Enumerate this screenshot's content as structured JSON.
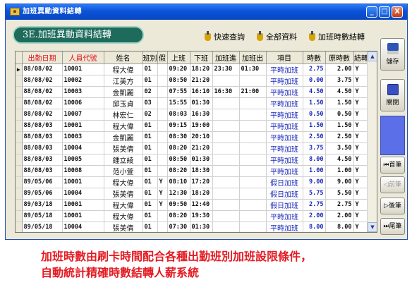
{
  "window": {
    "title": "加班異動資料結轉",
    "min_label": "_",
    "max_label": "□",
    "close_label": "X"
  },
  "header": {
    "section": "3E.加班異動資料結轉",
    "links": [
      "快速查詢",
      "全部資料",
      "加班時數結轉"
    ]
  },
  "table": {
    "columns": [
      "出勤日期",
      "人員代號",
      "姓名",
      "班別",
      "假",
      "上班",
      "下班",
      "加班進",
      "加班出",
      "項目",
      "時數",
      "原時數",
      "結轉"
    ],
    "rows": [
      [
        "88/08/02",
        "10001",
        "程大偉",
        "01",
        "",
        "09:20",
        "18:20",
        "23:30",
        "01:30",
        "平時加班",
        "2.75",
        "2.00",
        "Y"
      ],
      [
        "88/08/02",
        "10002",
        "江美方",
        "01",
        "",
        "08:50",
        "21:20",
        "",
        "",
        "平時加班",
        "0.00",
        "3.75",
        "Y"
      ],
      [
        "88/08/02",
        "10003",
        "金凱麗",
        "02",
        "",
        "07:55",
        "16:10",
        "16:30",
        "21:00",
        "平時加班",
        "4.50",
        "4.50",
        "Y"
      ],
      [
        "88/08/02",
        "10006",
        "邱玉貞",
        "03",
        "",
        "15:55",
        "01:30",
        "",
        "",
        "平時加班",
        "1.50",
        "1.50",
        "Y"
      ],
      [
        "88/08/02",
        "10007",
        "林宏仁",
        "02",
        "",
        "08:03",
        "16:30",
        "",
        "",
        "平時加班",
        "0.50",
        "0.50",
        "Y"
      ],
      [
        "88/08/03",
        "10001",
        "程大偉",
        "01",
        "",
        "09:15",
        "19:00",
        "",
        "",
        "平時加班",
        "1.50",
        "1.50",
        "Y"
      ],
      [
        "88/08/03",
        "10003",
        "金凱麗",
        "01",
        "",
        "08:30",
        "20:10",
        "",
        "",
        "平時加班",
        "2.50",
        "2.50",
        "Y"
      ],
      [
        "88/08/03",
        "10004",
        "張美倩",
        "01",
        "",
        "08:20",
        "21:20",
        "",
        "",
        "平時加班",
        "3.75",
        "3.50",
        "Y"
      ],
      [
        "88/08/03",
        "10005",
        "鍾立綾",
        "01",
        "",
        "08:50",
        "01:30",
        "",
        "",
        "平時加班",
        "8.00",
        "4.50",
        "Y"
      ],
      [
        "88/08/03",
        "10008",
        "范小萱",
        "01",
        "",
        "08:20",
        "18:30",
        "",
        "",
        "平時加班",
        "1.00",
        "1.00",
        "Y"
      ],
      [
        "89/05/06",
        "10001",
        "程大偉",
        "01",
        "Y",
        "08:10",
        "17:20",
        "",
        "",
        "假日加班",
        "9.00",
        "9.00",
        "Y"
      ],
      [
        "89/05/06",
        "10004",
        "張美倩",
        "01",
        "Y",
        "12:30",
        "18:20",
        "",
        "",
        "假日加班",
        "5.75",
        "5.50",
        "Y"
      ],
      [
        "89/03/18",
        "10001",
        "程大偉",
        "01",
        "Y",
        "09:50",
        "12:40",
        "",
        "",
        "假日加班",
        "2.75",
        "2.75",
        "Y"
      ],
      [
        "89/05/18",
        "10001",
        "程大偉",
        "01",
        "",
        "08:20",
        "19:30",
        "",
        "",
        "平時加班",
        "2.00",
        "2.00",
        "Y"
      ],
      [
        "89/05/18",
        "10004",
        "張美倩",
        "01",
        "",
        "07:30",
        "01:30",
        "",
        "",
        "平時加班",
        "8.00",
        "8.00",
        "Y"
      ]
    ]
  },
  "sidebar": {
    "save": "儲存",
    "exit": "關閉",
    "first": "首筆",
    "prev": "前筆",
    "next": "後筆",
    "last": "尾筆"
  },
  "caption": {
    "line1": "加班時數由刷卡時間配合各種出勤班別加班設限條件，",
    "line2": "自動統計精確時數結轉人薪系統"
  }
}
